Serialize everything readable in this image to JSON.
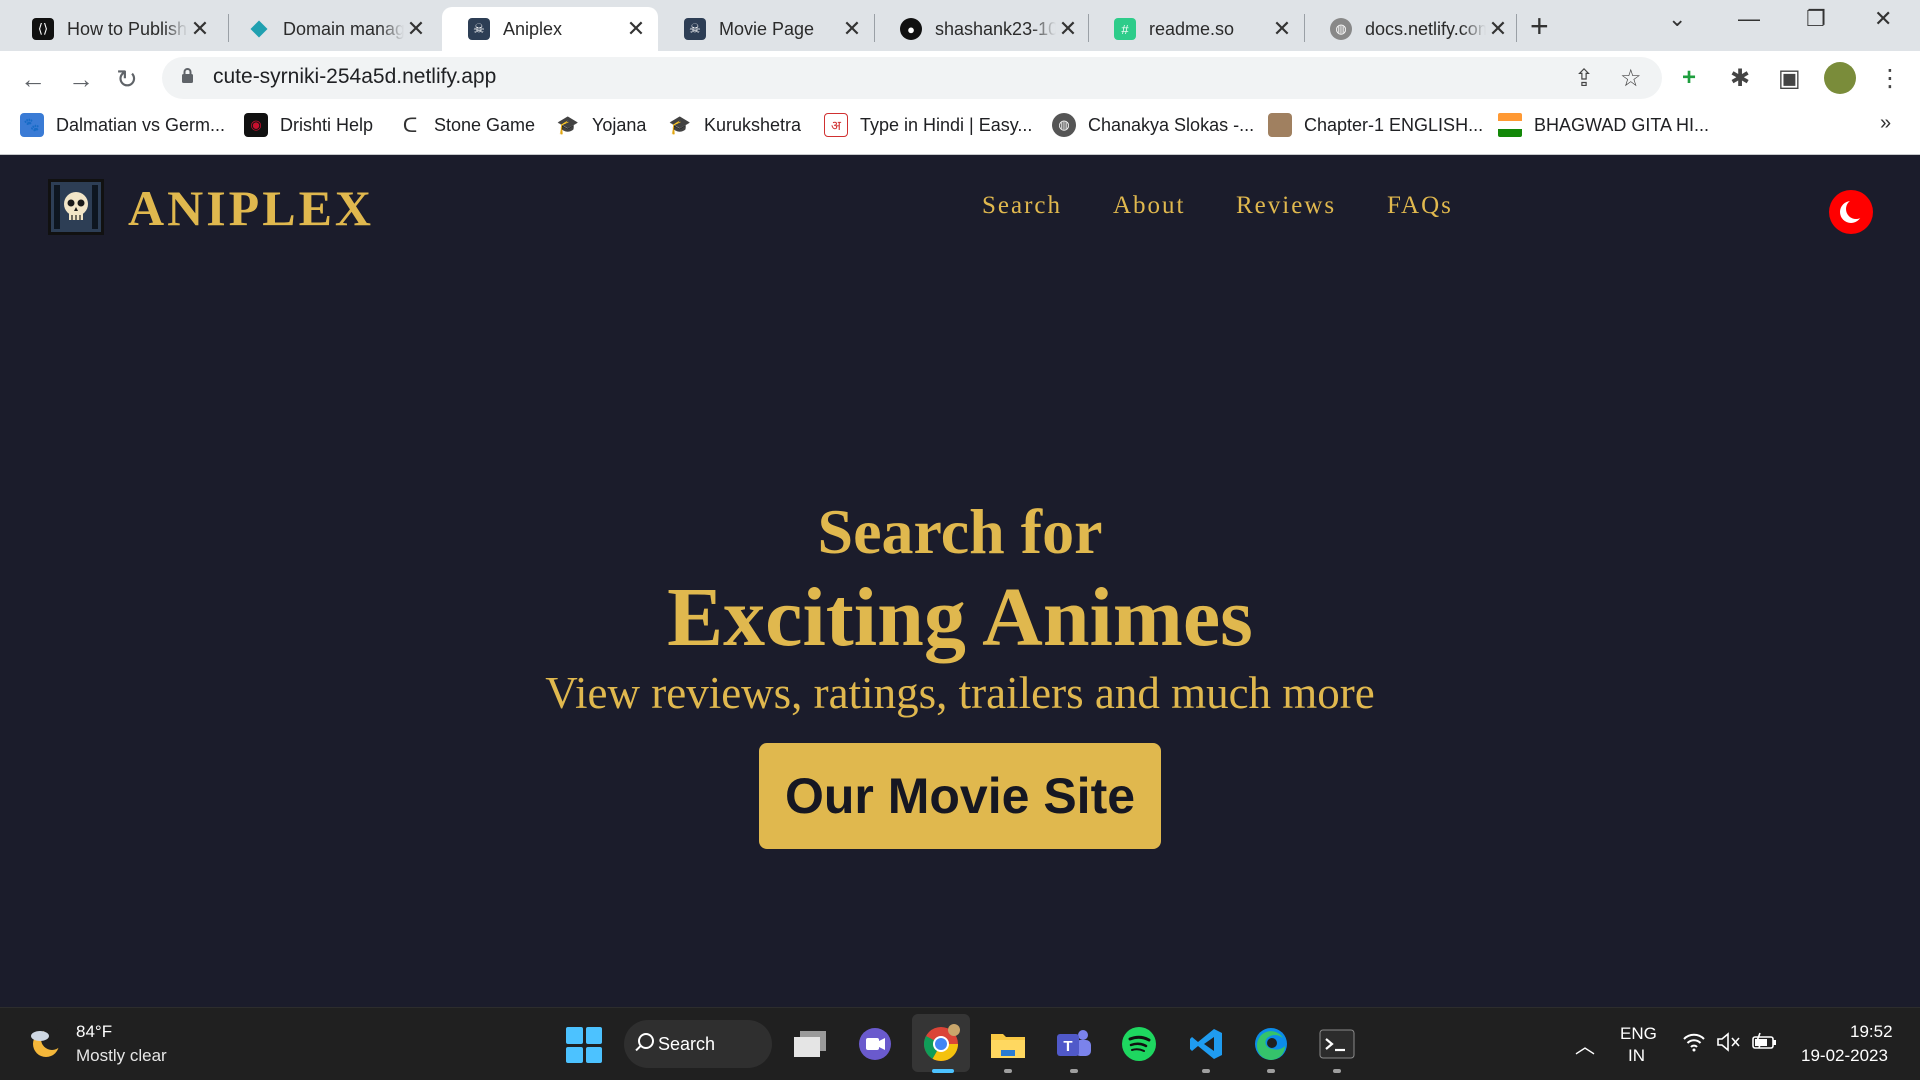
{
  "browser": {
    "tabs": [
      {
        "title": "How to Publish",
        "favicon": "hashnode-logo-icon",
        "color": "#111111"
      },
      {
        "title": "Domain manag",
        "favicon": "netlify-diamond-icon",
        "color": "#20a0b0"
      },
      {
        "title": "Aniplex",
        "favicon": "aniplex-skull-icon",
        "color": "#2d3e55"
      },
      {
        "title": "Movie Page",
        "favicon": "aniplex-skull-icon",
        "color": "#2d3e55"
      },
      {
        "title": "shashank23-10",
        "favicon": "github-icon",
        "color": "#111111"
      },
      {
        "title": "readme.so",
        "favicon": "readme-hash-icon",
        "color": "#2ecc8a"
      },
      {
        "title": "docs.netlify.com",
        "favicon": "globe-icon",
        "color": "#888888"
      }
    ],
    "active_tab_index": 2,
    "url": "cute-syrniki-254a5d.netlify.app",
    "bookmarks": [
      {
        "label": "Dalmatian vs Germ...",
        "icon": "paw-icon",
        "color": "#3a7bd5"
      },
      {
        "label": "Drishti Help",
        "icon": "drishti-icon",
        "color": "#c8102e"
      },
      {
        "label": "Stone Game",
        "icon": "leetcode-icon",
        "color": "#f0a12b"
      },
      {
        "label": "Yojana",
        "icon": "graduation-cap-icon",
        "color": "#f0b400"
      },
      {
        "label": "Kurukshetra",
        "icon": "graduation-cap-icon",
        "color": "#f0b400"
      },
      {
        "label": "Type in Hindi | Easy...",
        "icon": "hindi-letter-icon",
        "color": "#d03030"
      },
      {
        "label": "Chanakya Slokas -...",
        "icon": "globe-icon",
        "color": "#555555"
      },
      {
        "label": "Chapter-1 ENGLISH...",
        "icon": "book-cover-icon",
        "color": "#a08060"
      },
      {
        "label": "BHAGWAD GITA HI...",
        "icon": "india-flag-icon",
        "color": "#ff9933"
      }
    ],
    "bookmarks_more": "»"
  },
  "site": {
    "logo_text": "ANIPLEX",
    "nav": [
      "Search",
      "About",
      "Reviews",
      "FAQs"
    ],
    "hero": {
      "line1": "Search for",
      "line2": "Exciting Animes",
      "subtitle": "View reviews, ratings, trailers and much more",
      "cta": "Our Movie Site"
    },
    "colors": {
      "background": "#1b1c2b",
      "accent": "#e0b84e",
      "toggle": "#ff0000"
    }
  },
  "taskbar": {
    "weather_temp": "84°F",
    "weather_desc": "Mostly clear",
    "search_label": "Search",
    "lang_line1": "ENG",
    "lang_line2": "IN",
    "time": "19:52",
    "date": "19-02-2023"
  }
}
